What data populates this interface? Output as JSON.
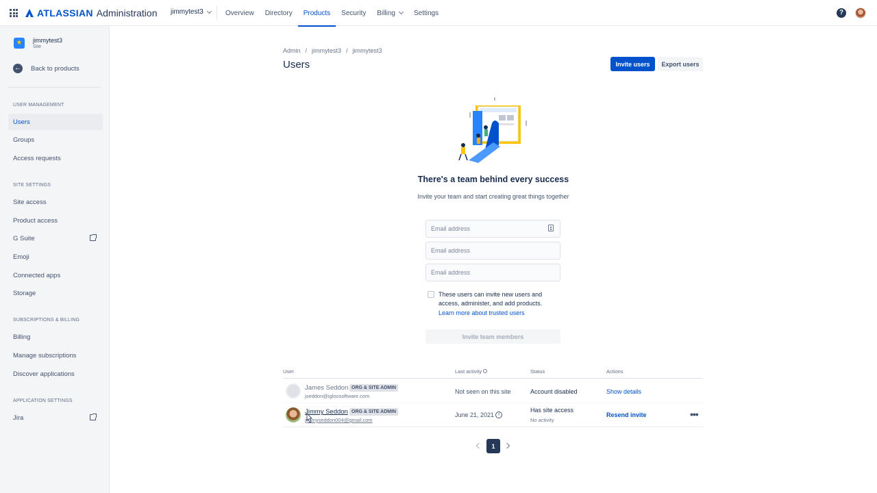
{
  "topbar": {
    "brand": "ATLASSIAN",
    "product": "Administration",
    "site_switcher": "jimmytest3",
    "nav": [
      "Overview",
      "Directory",
      "Products",
      "Security",
      "Billing",
      "Settings"
    ],
    "active_nav": "Products",
    "help_label": "?"
  },
  "sidebar": {
    "site_name": "jimmytest3",
    "site_type": "Site",
    "back_label": "Back to products",
    "sections": {
      "user_management": "USER MANAGEMENT",
      "site_settings": "SITE SETTINGS",
      "subscriptions": "SUBSCRIPTIONS & BILLING",
      "application_settings": "APPLICATION SETTINGS"
    },
    "items": {
      "users": "Users",
      "groups": "Groups",
      "access_requests": "Access requests",
      "site_access": "Site access",
      "product_access": "Product access",
      "g_suite": "G Suite",
      "emoji": "Emoji",
      "connected_apps": "Connected apps",
      "storage": "Storage",
      "billing": "Billing",
      "manage_subscriptions": "Manage subscriptions",
      "discover_applications": "Discover applications",
      "jira": "Jira"
    }
  },
  "main": {
    "breadcrumb": [
      "Admin",
      "jimmytest3",
      "jimmytest3"
    ],
    "title": "Users",
    "invite_button": "Invite users",
    "export_button": "Export users",
    "empty_title": "There's a team behind every success",
    "empty_subtitle": "Invite your team and start creating great things together",
    "email_placeholder": "Email address",
    "trusted_text": "These users can invite new users and access, administer, and add products.",
    "trusted_link": "Learn more about trusted users",
    "invite_team_button": "Invite team members"
  },
  "table": {
    "headers": {
      "user": "User",
      "last_activity": "Last activity",
      "status": "Status",
      "actions": "Actions"
    },
    "rows": [
      {
        "name": "James Seddon",
        "badge": "ORG & SITE ADMIN",
        "email": "jseddon@igloosoftware.com",
        "last_activity": "Not seen on this site",
        "status": "Account disabled",
        "status_sub": "",
        "action": "Show details"
      },
      {
        "name": "Jimmy Seddon",
        "badge": "ORG & SITE ADMIN",
        "email": "jimmyseddon004@gmail.com",
        "last_activity": "June 21, 2021",
        "status": "Has site access",
        "status_sub": "No activity",
        "action": "Resend invite"
      }
    ]
  },
  "pagination": {
    "current_page": "1"
  },
  "colors": {
    "brand": "#0052cc",
    "text": "#172b4d",
    "sidebar_bg": "#f4f5f7"
  }
}
